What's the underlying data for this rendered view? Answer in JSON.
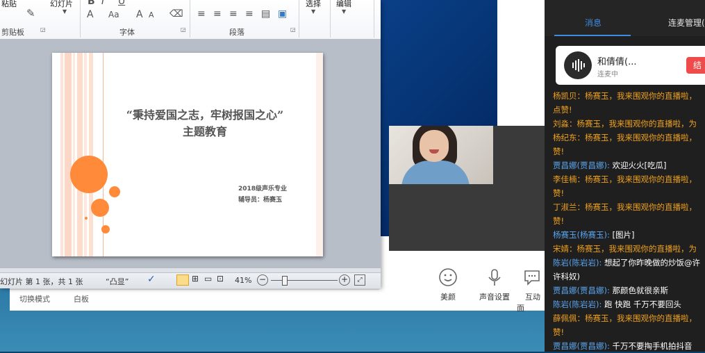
{
  "ribbon": {
    "paste": "粘贴",
    "slides": "幻灯片",
    "clipboard": "剪贴板",
    "font": "字体",
    "paragraph": "段落",
    "select": "选择",
    "edit": "编辑",
    "fontA": "A",
    "fontAa": "Aa",
    "fontGrow": "A",
    "fontShrink": "A"
  },
  "slide": {
    "title_line1": "“秉持爱国之志，牢树报国之心”",
    "title_line2": "主题教育",
    "info_line1": "2018级声乐专业",
    "info_line2": "辅导员：杨赛玉"
  },
  "status": {
    "slide_info": "幻灯片 第 1 张，共 1 张",
    "theme": "“凸显”",
    "zoom": "41%",
    "zoom_fraction": 0.41
  },
  "live": {
    "bottom_left": "切换模式",
    "bottom_mid": "白板",
    "beauty": "美颜",
    "sound": "声音设置",
    "interact": "互动面"
  },
  "chat": {
    "tab_messages": "消息",
    "tab_mic": "连麦管理(",
    "card_name": "和倩倩(...",
    "card_status": "连麦中",
    "card_button": "结",
    "messages": [
      {
        "name": "杨凯贝：",
        "text": "杨赛玉，我来围观你的直播啦，",
        "ncolor": "y"
      },
      {
        "name": "",
        "text": "点赞!",
        "ncolor": "y"
      },
      {
        "name": "刘淼：",
        "text": "杨赛玉，我来围观你的直播啦，为",
        "ncolor": "y"
      },
      {
        "name": "杨纪东：",
        "text": "杨赛玉，我来围观你的直播啦，",
        "ncolor": "y"
      },
      {
        "name": "",
        "text": "赞!",
        "ncolor": "y"
      },
      {
        "name": "贾昌娜(贾昌娜):",
        "text": " 欢迎火火[吃瓜]",
        "ncolor": "b"
      },
      {
        "name": "李佳楠：",
        "text": "杨赛玉，我来围观你的直播啦，",
        "ncolor": "y"
      },
      {
        "name": "",
        "text": "赞!",
        "ncolor": "y"
      },
      {
        "name": "丁淑兰：",
        "text": "杨赛玉，我来围观你的直播啦，",
        "ncolor": "y"
      },
      {
        "name": "",
        "text": "赞!",
        "ncolor": "y"
      },
      {
        "name": "杨赛玉(杨赛玉):",
        "text": " [图片]",
        "ncolor": "b"
      },
      {
        "name": "宋婧：",
        "text": "杨赛玉，我来围观你的直播啦，为",
        "ncolor": "y"
      },
      {
        "name": "陈岩(陈岩岩):",
        "text": " 想起了你昨晚做的炒饭@许",
        "ncolor": "b"
      },
      {
        "name": "",
        "text": "许科奴)",
        "ncolor": "w"
      },
      {
        "name": "贾昌娜(贾昌娜):",
        "text": " 那颜色就很亲斯",
        "ncolor": "b"
      },
      {
        "name": "陈岩(陈岩岩):",
        "text": " 跑   快跑    千万不要回头",
        "ncolor": "b"
      },
      {
        "name": "薛佩佩：",
        "text": "杨赛玉，我来围观你的直播啦，",
        "ncolor": "y"
      },
      {
        "name": "",
        "text": "赞!",
        "ncolor": "y"
      },
      {
        "name": "贾昌娜(贾昌娜):",
        "text": " 千万不要掏手机拍抖音",
        "ncolor": "b"
      }
    ]
  }
}
